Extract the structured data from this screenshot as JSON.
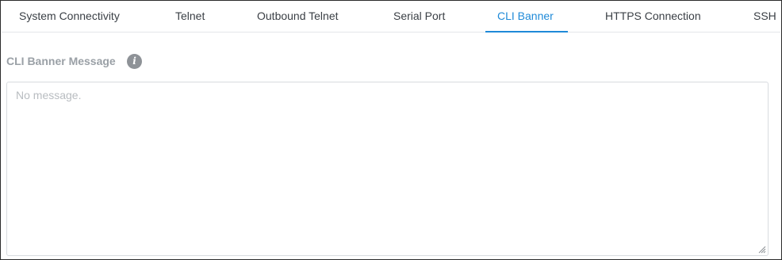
{
  "tabs": [
    {
      "label": "System Connectivity",
      "active": false
    },
    {
      "label": "Telnet",
      "active": false
    },
    {
      "label": "Outbound Telnet",
      "active": false
    },
    {
      "label": "Serial Port",
      "active": false
    },
    {
      "label": "CLI Banner",
      "active": true
    },
    {
      "label": "HTTPS Connection",
      "active": false
    },
    {
      "label": "SSH",
      "active": false
    }
  ],
  "section": {
    "title": "CLI Banner Message",
    "info_icon": "info-icon"
  },
  "banner_input": {
    "value": "",
    "placeholder": "No message."
  },
  "colors": {
    "accent": "#1f8ad8",
    "tab_text": "#3a3f45",
    "label_text": "#9aa0a6"
  }
}
